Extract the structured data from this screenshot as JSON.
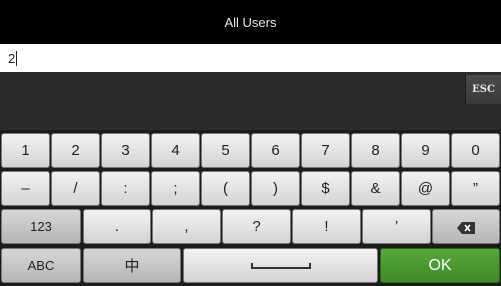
{
  "header": {
    "title": "All Users"
  },
  "search": {
    "value": "2"
  },
  "keyboard": {
    "esc_label": "ESC",
    "row1": [
      "1",
      "2",
      "3",
      "4",
      "5",
      "6",
      "7",
      "8",
      "9",
      "0"
    ],
    "row2": [
      "–",
      "/",
      ":",
      ";",
      "(",
      ")",
      "$",
      "&",
      "@",
      "”"
    ],
    "row3": {
      "mode_label": "123",
      "keys": [
        ".",
        ",",
        "?",
        "!",
        "’"
      ],
      "backspace_icon": "backspace-icon"
    },
    "row4": {
      "abc_label": "ABC",
      "chinese_label": "中",
      "space_icon": "space-icon",
      "ok_label": "OK"
    },
    "colors": {
      "ok": "#4a9a30",
      "background": "#1c1c1c"
    }
  }
}
